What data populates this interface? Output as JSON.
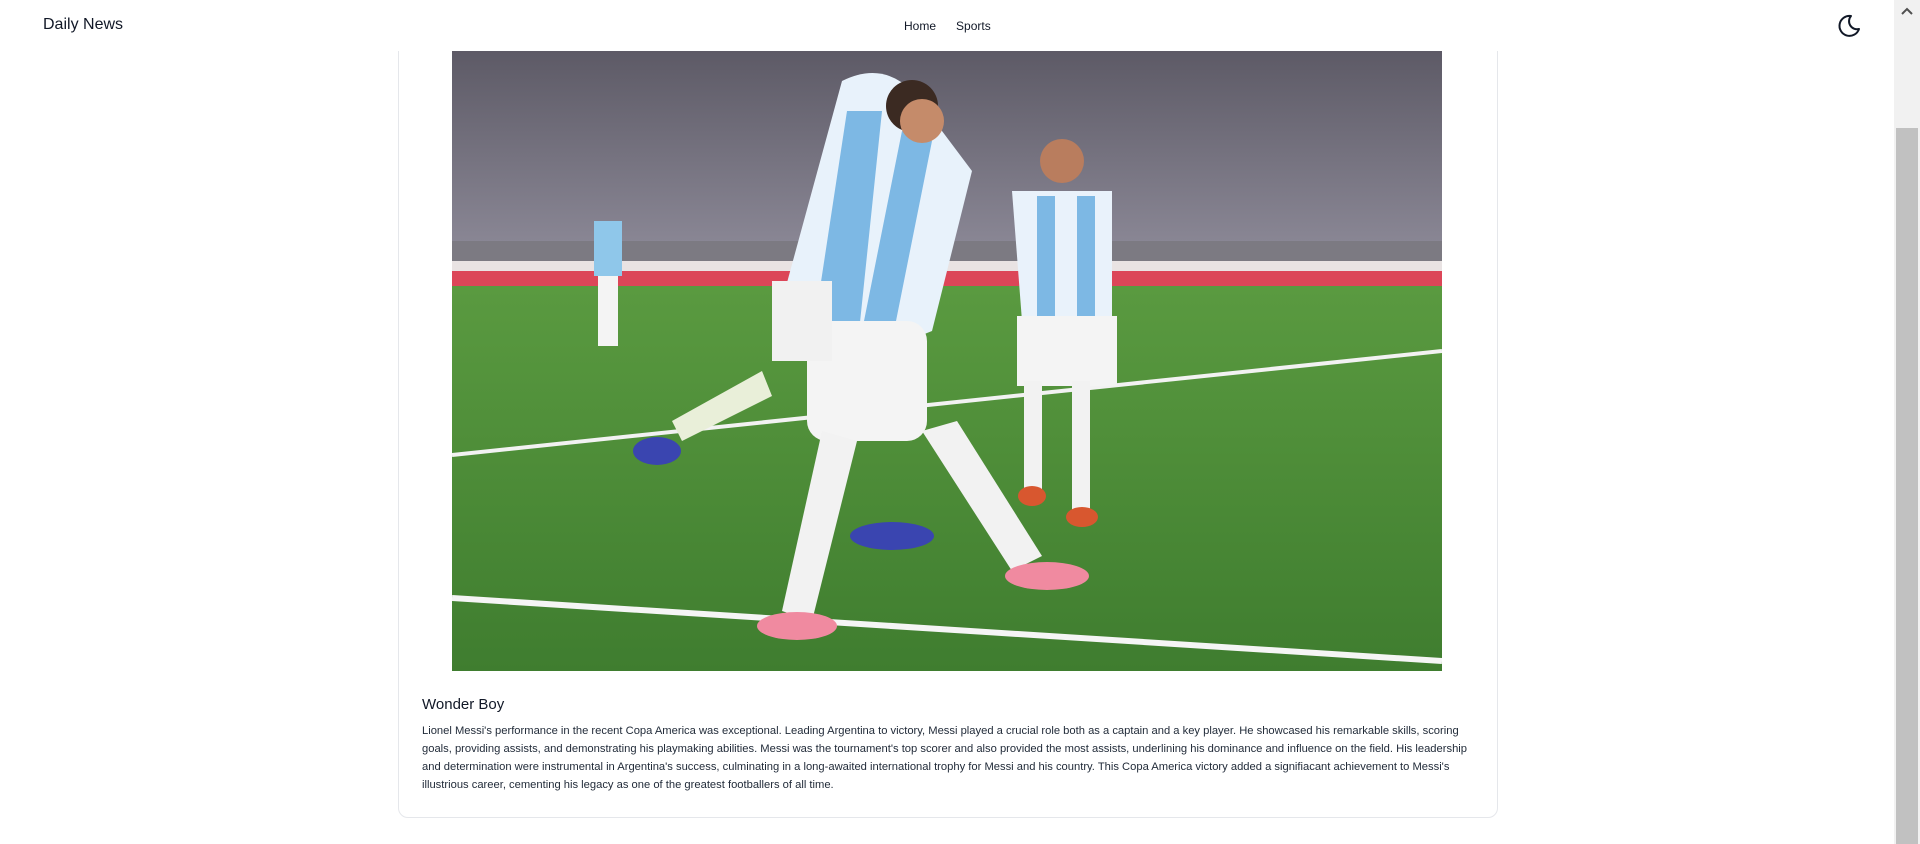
{
  "header": {
    "brand": "Daily News",
    "nav": [
      {
        "label": "Home"
      },
      {
        "label": "Sports"
      }
    ],
    "theme_icon": "moon-icon"
  },
  "article": {
    "image_icon": "photo-image",
    "title": "Wonder Boy",
    "body": "Lionel Messi's performance in the recent Copa America was exceptional. Leading Argentina to victory, Messi played a crucial role both as a captain and a key player. He showcased his remarkable skills, scoring goals, providing assists, and demonstrating his playmaking abilities. Messi was the tournament's top scorer and also provided the most assists, underlining his dominance and influence on the field. His leadership and determination were instrumental in Argentina's success, culminating in a long-awaited international trophy for Messi and his country. This Copa America victory added a signifiacant achievement to Messi's illustrious career, cementing his legacy as one of the greatest footballers of all time."
  },
  "colors": {
    "pitch": "#4e8f3a",
    "stand": "#6f6b78",
    "banner": "#d92a3f",
    "kit_blue": "#79b9e6"
  }
}
